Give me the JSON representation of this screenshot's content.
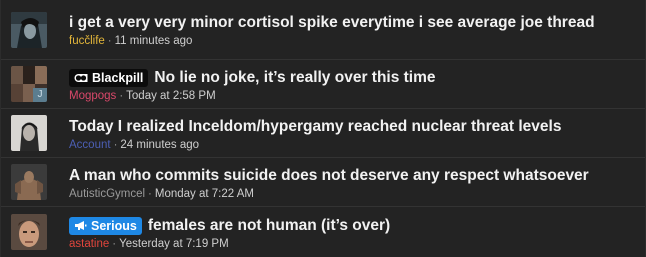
{
  "threads": [
    {
      "title": "i get a very very minor cortisol spike everytime i see average joe thread",
      "prefix": "",
      "author": "fucčlife",
      "author_color": "#e3b63a",
      "time": "11 minutes ago"
    },
    {
      "title": "No lie no joke, it’s really over this time",
      "prefix": "Blackpill",
      "author": "Mogpogs",
      "author_color": "#d9486a",
      "time": "Today at 2:58 PM",
      "avatar_letter": "J"
    },
    {
      "title": "Today I realized Inceldom/hypergamy reached nuclear threat levels",
      "prefix": "",
      "author": "Account",
      "author_color": "#4c5fb5",
      "time": "24 minutes ago"
    },
    {
      "title": "A man who commits suicide does not deserve any respect whatsoever",
      "prefix": "",
      "author": "AutisticGymcel",
      "author_color": "#9a9a9a",
      "time": "Monday at 7:22 AM"
    },
    {
      "title": "females are not human (it’s over)",
      "prefix": "Serious",
      "author": "astatine",
      "author_color": "#e0453c",
      "time": "Yesterday at 7:19 PM"
    }
  ],
  "meta_separator": "·"
}
